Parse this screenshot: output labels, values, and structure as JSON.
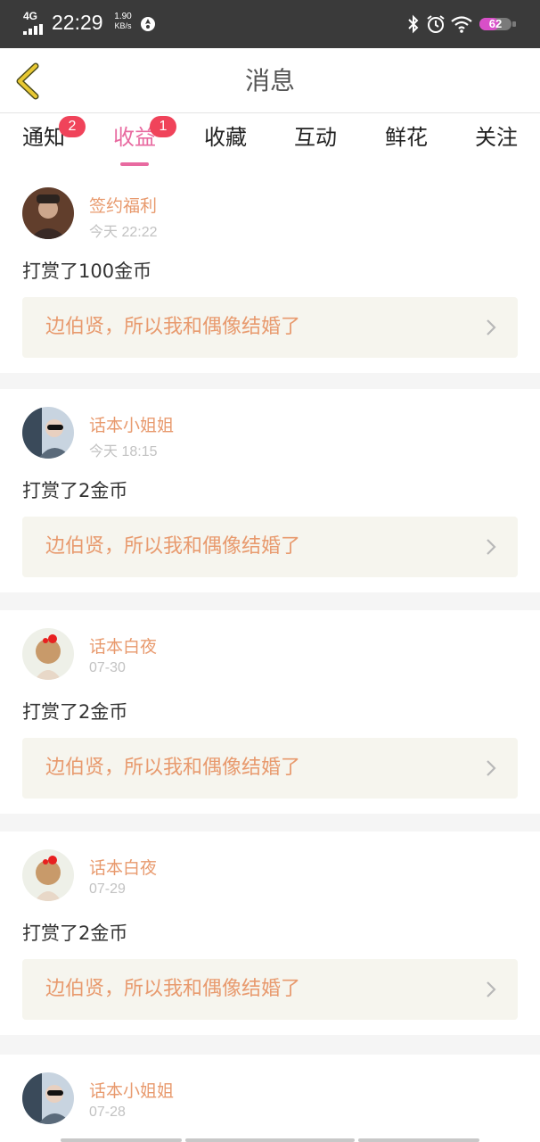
{
  "status_bar": {
    "network": "4G",
    "time": "22:29",
    "speed_value": "1.90",
    "speed_unit": "KB/s",
    "battery": "62",
    "battery_level": 0.62,
    "icons": [
      "signal-icon",
      "app-notification-icon",
      "bluetooth-icon",
      "alarm-icon",
      "wifi-icon",
      "battery-icon"
    ]
  },
  "header": {
    "title": "消息",
    "back_icon": "back-chevron-icon"
  },
  "tabs": [
    {
      "label": "通知",
      "badge": "2",
      "active": false
    },
    {
      "label": "收益",
      "badge": "1",
      "active": true
    },
    {
      "label": "收藏",
      "badge": null,
      "active": false
    },
    {
      "label": "互动",
      "badge": null,
      "active": false
    },
    {
      "label": "鲜花",
      "badge": null,
      "active": false
    },
    {
      "label": "关注",
      "badge": null,
      "active": false
    }
  ],
  "messages": [
    {
      "sender": "签约福利",
      "time": "今天 22:22",
      "text": "打赏了100金币",
      "book": "边伯贤，所以我和偶像结婚了"
    },
    {
      "sender": "话本小姐姐",
      "time": "今天 18:15",
      "text": "打赏了2金币",
      "book": "边伯贤，所以我和偶像结婚了"
    },
    {
      "sender": "话本白夜",
      "time": "07-30",
      "text": "打赏了2金币",
      "book": "边伯贤，所以我和偶像结婚了"
    },
    {
      "sender": "话本白夜",
      "time": "07-29",
      "text": "打赏了2金币",
      "book": "边伯贤，所以我和偶像结婚了"
    },
    {
      "sender": "话本小姐姐",
      "time": "07-28"
    }
  ],
  "colors": {
    "accent": "#e86aa0",
    "badge": "#f0435a",
    "sender": "#e89a6e",
    "book_bg": "#f6f5ee",
    "status_bar_bg": "#3a3a3a",
    "back_icon": "#e8c832"
  }
}
